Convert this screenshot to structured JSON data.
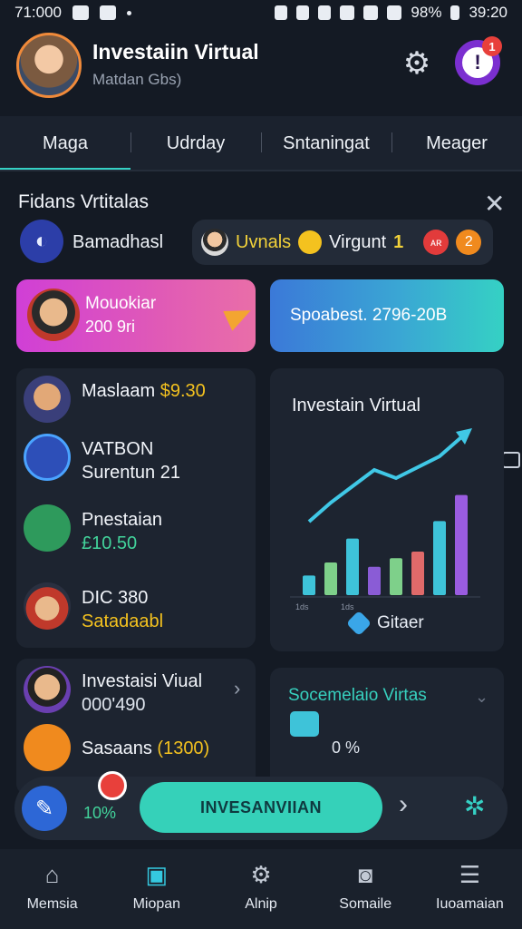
{
  "status_bar": {
    "time": "71:000",
    "battery": "98%",
    "clock": "39:20"
  },
  "header": {
    "title": "Investaiin Virtual",
    "subtitle": "Matdan Gbs)",
    "notification_count": "1"
  },
  "tabs": [
    {
      "label": "Maga",
      "active": true
    },
    {
      "label": "Udrday",
      "active": false
    },
    {
      "label": "Sntaningat",
      "active": false
    },
    {
      "label": "Meager",
      "active": false
    }
  ],
  "section": {
    "title": "Fidans Vrtitalas"
  },
  "chips": {
    "label": "Bamadhasl",
    "pill_text": "Uvnals",
    "pill_text2": "Virgunt",
    "pill_number": "1",
    "badge_a": "ᴀʀ",
    "badge_b": "2"
  },
  "promo_cards": {
    "pink": {
      "name": "Mouokiar",
      "value": "200 9ri"
    },
    "teal": {
      "label": "Spoabest. 2796-20B"
    }
  },
  "list": [
    {
      "name": "Maslaam",
      "value": "$9.30",
      "value_color": "#f4c21f"
    },
    {
      "name": "VATBON",
      "value": "Surentun 21",
      "value_color": "#f2f5fa"
    },
    {
      "name": "Pnestaian",
      "value": "£10.50",
      "value_color": "#42d39b"
    },
    {
      "name": "DIC 380",
      "value": "Satadaabl",
      "value_color": "#f4c21f"
    }
  ],
  "chart_data": {
    "type": "bar",
    "title": "Investain Virtual",
    "legend_label": "Gitaer",
    "values": [
      18,
      30,
      52,
      26,
      34,
      40,
      68,
      92
    ],
    "line_values": [
      34,
      48,
      60,
      72,
      66,
      74,
      82,
      96
    ],
    "x_labels": [
      "1ds",
      "1ds"
    ]
  },
  "bottom_list": [
    {
      "name": "Investaisi Viual",
      "value": "000'490"
    },
    {
      "name": "Sasaans",
      "value": "(1300)"
    }
  ],
  "status_card": {
    "title": "Socemelaio Virtas",
    "percent": "0 %"
  },
  "action_bar": {
    "percent": "10%",
    "cta": "INVESANVIIAN"
  },
  "bottom_nav": [
    {
      "label": "Memsia",
      "icon": "home-icon"
    },
    {
      "label": "Miopan",
      "icon": "card-icon",
      "active": true
    },
    {
      "label": "Alnip",
      "icon": "gear-icon"
    },
    {
      "label": "Somaile",
      "icon": "camera-icon"
    },
    {
      "label": "Iuoamaian",
      "icon": "menu-icon"
    }
  ]
}
